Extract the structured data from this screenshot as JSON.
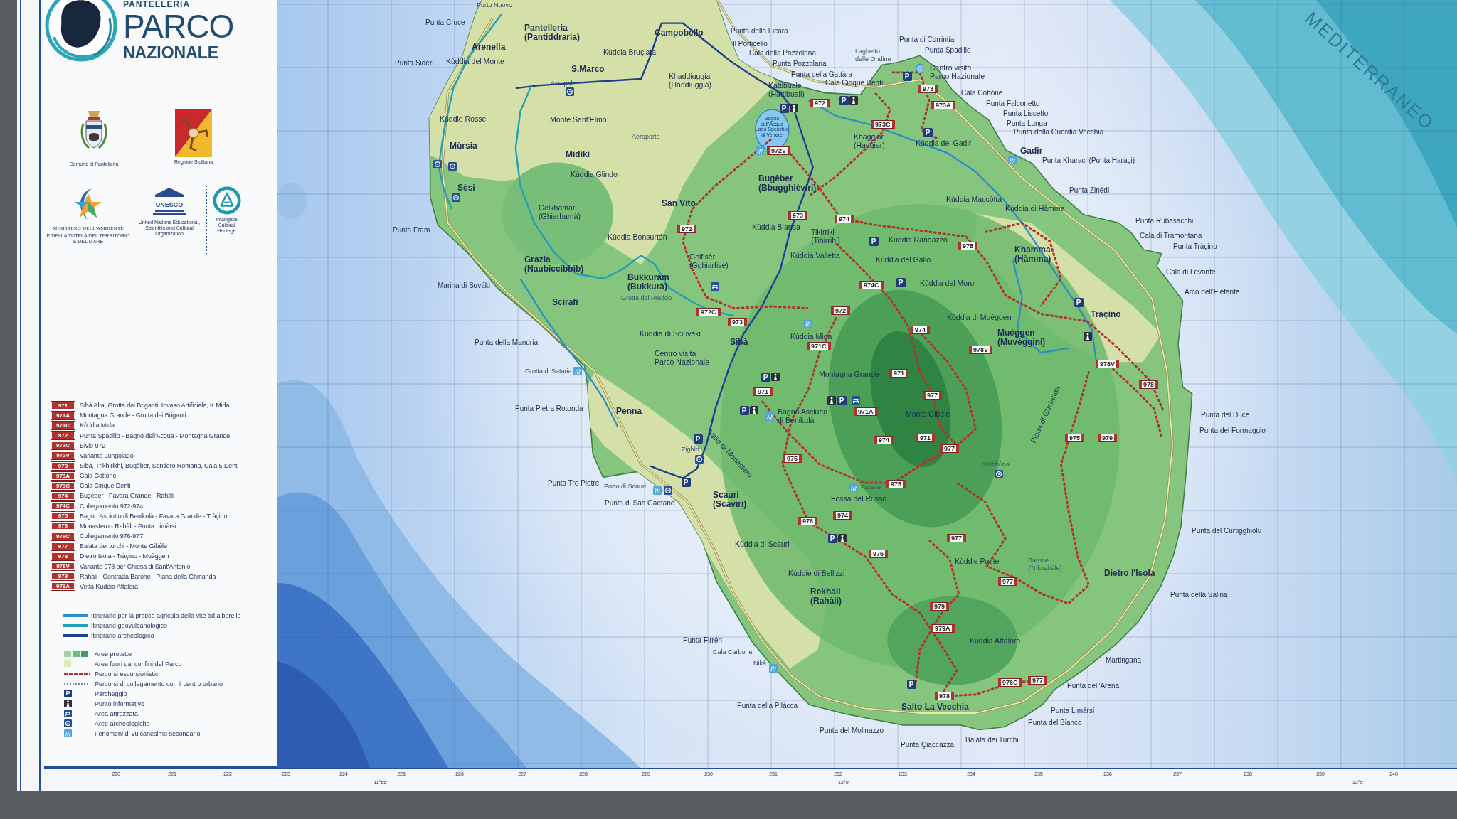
{
  "header": {
    "island_name": "PANTELLERIA",
    "title": "PARCO",
    "subtitle": "NAZIONALE"
  },
  "logos": {
    "comune": "Comune di Pantelleria",
    "regione": "Regione Siciliana",
    "ministero": "MINISTERO DELL'AMBIENTE",
    "ministero_sub": "E DELLA TUTELA DEL TERRITORIO E DEL MARE",
    "unesco_mark": "UNESCO",
    "unesco": "United Nations Educational, Scientific and Cultural Organization",
    "heritage": "Intangible Cultural Heritage"
  },
  "legend": {
    "trails": [
      {
        "code": "971",
        "name": "Sibà Alta, Grotta dei Briganti, Invaso Artificiale, K.Mida"
      },
      {
        "code": "971A",
        "name": "Montagna Grande - Grotta dei Briganti"
      },
      {
        "code": "971C",
        "name": "Kùddia Mida"
      },
      {
        "code": "972",
        "name": "Punta Spadillo - Bagno dell'Acqua - Montagna Grande"
      },
      {
        "code": "972C",
        "name": "Bivio 972"
      },
      {
        "code": "972V",
        "name": "Variante Lungolago"
      },
      {
        "code": "973",
        "name": "Sibà, Trikhirikhi, Bugèber, Sentiero Romano, Cala 5 Denti"
      },
      {
        "code": "973A",
        "name": "Cala Cottòne"
      },
      {
        "code": "973C",
        "name": "Cala Cinque Denti"
      },
      {
        "code": "974",
        "name": "Bugèber - Favara Grande - Rahàli"
      },
      {
        "code": "974C",
        "name": "Collegamento 972-974"
      },
      {
        "code": "975",
        "name": "Bagno Asciutto di Benikulà - Favara Grande - Tràçino"
      },
      {
        "code": "976",
        "name": "Monastero - Rahàli - Punta Limàrsi"
      },
      {
        "code": "976C",
        "name": "Collegamento 976-977"
      },
      {
        "code": "977",
        "name": "Balata dei turchi - Monte Gibèle"
      },
      {
        "code": "978",
        "name": "Dietro Isola - Tràçino - Muèggen"
      },
      {
        "code": "978V",
        "name": "Variante 978 per Chiesa di Sant'Antonio"
      },
      {
        "code": "979",
        "name": "Rahàli - Contrada Barone - Piana della Ghirlanda"
      },
      {
        "code": "979A",
        "name": "Vetta Kùddia Attalòra"
      }
    ],
    "routes": [
      {
        "label": "Itinerario per la pratica agricola della vite ad alberello",
        "color": "#2f8fc4"
      },
      {
        "label": "Itinerario geovulcanologico",
        "color": "#21a0b5"
      },
      {
        "label": "Itinerario archeologico",
        "color": "#213f8f"
      }
    ],
    "symbols": [
      {
        "kind": "protected",
        "label": "Aree protette"
      },
      {
        "kind": "outside",
        "label": "Aree fuori dai confini del Parco"
      },
      {
        "kind": "trail",
        "label": "Percorsi escursionistici"
      },
      {
        "kind": "link",
        "label": "Percorsi di collegamento con il centro urbano"
      },
      {
        "kind": "parking",
        "symbol": "P",
        "label": "Parcheggio"
      },
      {
        "kind": "info",
        "label": "Punto informativo"
      },
      {
        "kind": "picnic",
        "label": "Area attrezzata"
      },
      {
        "kind": "archaeology",
        "label": "Aree archeologiche"
      },
      {
        "kind": "steam",
        "label": "Fenomeni di vulcanesimo secondario"
      }
    ]
  },
  "map": {
    "sea_name": "MEDITERRANEO",
    "coast_labels": [
      {
        "kind": "minor",
        "name": "Porto Nuovo"
      },
      {
        "kind": "point",
        "name": "Punta Croce"
      },
      {
        "kind": "point",
        "name": "Punta della Ficàra"
      },
      {
        "kind": "point",
        "name": "Il Porticello"
      },
      {
        "kind": "point",
        "name": "Punta di Currintia"
      },
      {
        "kind": "point",
        "name": "Cala della Pozzolana"
      },
      {
        "kind": "point",
        "name": "Punta Spadillo"
      },
      {
        "kind": "point",
        "name": "Punta Sidéri"
      },
      {
        "kind": "point",
        "name": "Punta Pozzolana"
      },
      {
        "kind": "point",
        "name": "Punta della Gattàra"
      },
      {
        "kind": "point",
        "name": "Cala Cinque Denti"
      },
      {
        "kind": "point",
        "name": "Cala Cottóne"
      },
      {
        "kind": "point",
        "name": "Punta Falconetto"
      },
      {
        "kind": "point",
        "name": "Punta Liscetto"
      },
      {
        "kind": "point",
        "name": "Punta Lunga"
      },
      {
        "kind": "point",
        "name": "Punta della Guardia Vecchia"
      },
      {
        "kind": "point",
        "name": "Punta Kharaci (Punta Haràçi)"
      },
      {
        "kind": "point",
        "name": "Punta Zinédi"
      },
      {
        "kind": "point",
        "name": "Punta Rubasacchi"
      },
      {
        "kind": "point",
        "name": "Punta Fram"
      },
      {
        "kind": "point",
        "name": "Cala di Tramontana"
      },
      {
        "kind": "point",
        "name": "Punta Tràçino"
      },
      {
        "kind": "point",
        "name": "Cala di Levante"
      },
      {
        "kind": "point",
        "name": "Marina di Suváki"
      },
      {
        "kind": "point",
        "name": "Arco dell'Elefante"
      },
      {
        "kind": "point",
        "name": "Punta della Mandria"
      },
      {
        "kind": "minor",
        "name": "Grotta di Sataria"
      },
      {
        "kind": "point",
        "name": "Punta Pietra Rotonda"
      },
      {
        "kind": "point",
        "name": "Punta del Duce"
      },
      {
        "kind": "point",
        "name": "Punta del Formaggio"
      },
      {
        "kind": "point",
        "name": "Punta Tre Pietre"
      },
      {
        "kind": "minor",
        "name": "Porto di Scauri"
      },
      {
        "kind": "point",
        "name": "Punta di San Gaetano"
      },
      {
        "kind": "point",
        "name": "Punta del Curtigghiólu"
      },
      {
        "kind": "point",
        "name": "Punta della Salina"
      },
      {
        "kind": "point",
        "name": "Punta Firréri"
      },
      {
        "kind": "minor",
        "name": "Cala Carbone"
      },
      {
        "kind": "minor",
        "name": "Nikà"
      },
      {
        "kind": "point",
        "name": "Martingana"
      },
      {
        "kind": "point",
        "name": "Punta dell'Arena"
      },
      {
        "kind": "point",
        "name": "Punta della Pilácca"
      },
      {
        "kind": "point",
        "name": "Punta Limársi"
      },
      {
        "kind": "point",
        "name": "Punta del Bianco"
      },
      {
        "kind": "point",
        "name": "Punta del Molinazzo"
      },
      {
        "kind": "point",
        "name": "Punta Çiaccàzza"
      },
      {
        "kind": "point",
        "name": "Baláta dei Turchi"
      }
    ],
    "place_labels": [
      {
        "kind": "town",
        "lines": [
          "Pantelleria",
          "(Pantiddraria)"
        ]
      },
      {
        "kind": "town",
        "lines": [
          "Campobello"
        ]
      },
      {
        "kind": "town",
        "lines": [
          "Arenella"
        ]
      },
      {
        "kind": "locality",
        "lines": [
          "Kùddia Bruçiata"
        ]
      },
      {
        "kind": "locality",
        "lines": [
          "Kùddia del Monte"
        ]
      },
      {
        "kind": "minor",
        "lines": [
          "Laghetto",
          "delle Ondine"
        ]
      },
      {
        "kind": "town",
        "lines": [
          "S.Marco"
        ]
      },
      {
        "kind": "minor",
        "lines": [
          "Acropoli"
        ]
      },
      {
        "kind": "locality",
        "lines": [
          "Khaddiuggia",
          "(Hàddiuggia)"
        ]
      },
      {
        "kind": "locality",
        "lines": [
          "Centro visita",
          "Parco Nazionale"
        ]
      },
      {
        "kind": "locality",
        "lines": [
          "Kattibuale",
          "(Hattibuali)"
        ]
      },
      {
        "kind": "locality",
        "lines": [
          "Kùddie Rosse"
        ]
      },
      {
        "kind": "locality",
        "lines": [
          "Monte Sant'Elmo"
        ]
      },
      {
        "kind": "minor",
        "lines": [
          "Aeroporto"
        ]
      },
      {
        "kind": "lake",
        "lines": [
          "Bagno",
          "dell'Acqua",
          "Lago Specchio",
          "di Venere"
        ]
      },
      {
        "kind": "town",
        "lines": [
          "Mùrsia"
        ]
      },
      {
        "kind": "locality",
        "lines": [
          "Khaggiar",
          "(Haggiar)"
        ]
      },
      {
        "kind": "locality",
        "lines": [
          "Kùddia del Gadir"
        ]
      },
      {
        "kind": "town",
        "lines": [
          "Midìki"
        ]
      },
      {
        "kind": "town",
        "lines": [
          "Gadir"
        ]
      },
      {
        "kind": "locality",
        "lines": [
          "Kùddia Glindo"
        ]
      },
      {
        "kind": "town",
        "lines": [
          "Sèsi"
        ]
      },
      {
        "kind": "town",
        "lines": [
          "Bugèber",
          "(Bbugghièviri)"
        ]
      },
      {
        "kind": "locality",
        "lines": [
          "Gelkhamar",
          "(Ghiarhamà)"
        ]
      },
      {
        "kind": "town",
        "lines": [
          "San Vito"
        ]
      },
      {
        "kind": "locality",
        "lines": [
          "Kùddia Maccòtta"
        ]
      },
      {
        "kind": "locality",
        "lines": [
          "Kùddia di Hàmma"
        ]
      },
      {
        "kind": "locality",
        "lines": [
          "Kùddia Bianca"
        ]
      },
      {
        "kind": "locality",
        "lines": [
          "Kùddia Bonsurtón"
        ]
      },
      {
        "kind": "locality",
        "lines": [
          "Tikirriki",
          "(Tihirrihi)"
        ]
      },
      {
        "kind": "locality",
        "lines": [
          "Kùddia Randazzo"
        ]
      },
      {
        "kind": "town",
        "lines": [
          "Grazia",
          "(Naubiccibbib)"
        ]
      },
      {
        "kind": "locality",
        "lines": [
          "Gelfisèr",
          "(Gghiarfisè)"
        ]
      },
      {
        "kind": "locality",
        "lines": [
          "Kùddia Valletta"
        ]
      },
      {
        "kind": "locality",
        "lines": [
          "Kùddia del Gallo"
        ]
      },
      {
        "kind": "town",
        "lines": [
          "Khamma",
          "(Hàmma)"
        ]
      },
      {
        "kind": "town",
        "lines": [
          "Bukkuram",
          "(Bukkurà)"
        ]
      },
      {
        "kind": "locality",
        "lines": [
          "Kùddia del Moro"
        ]
      },
      {
        "kind": "town",
        "lines": [
          "Scirafi"
        ]
      },
      {
        "kind": "minor",
        "lines": [
          "Grotta del Preddo"
        ]
      },
      {
        "kind": "locality",
        "lines": [
          "Kùddia di Muéggen"
        ]
      },
      {
        "kind": "town",
        "lines": [
          "Tràçino"
        ]
      },
      {
        "kind": "locality",
        "lines": [
          "Kùddia di Sciuvèki"
        ]
      },
      {
        "kind": "town",
        "lines": [
          "Sibà"
        ]
      },
      {
        "kind": "locality",
        "lines": [
          "Kùddia Mida"
        ]
      },
      {
        "kind": "town",
        "lines": [
          "Muéggen",
          "(Muvèggini)"
        ]
      },
      {
        "kind": "locality",
        "lines": [
          "Centro visita",
          "Parco Nazionale"
        ]
      },
      {
        "kind": "locality",
        "lines": [
          "Montagna Grande"
        ]
      },
      {
        "kind": "town",
        "lines": [
          "Penna"
        ]
      },
      {
        "kind": "locality",
        "lines": [
          "Bagno Asciutto",
          "di Benikulà"
        ]
      },
      {
        "kind": "locality",
        "lines": [
          "Monte Gibéle"
        ]
      },
      {
        "kind": "minor",
        "lines": [
          "Zighìd"
        ]
      },
      {
        "kind": "locality",
        "lines": [
          "Valle di Monastero"
        ]
      },
      {
        "kind": "locality",
        "lines": [
          "Piana di Ghirlanda"
        ]
      },
      {
        "kind": "minor",
        "lines": [
          "Ghibbùna"
        ]
      },
      {
        "kind": "town",
        "lines": [
          "Scauri",
          "(Scàviri)"
        ]
      },
      {
        "kind": "locality",
        "lines": [
          "Fossa del Russo"
        ]
      },
      {
        "kind": "minor",
        "lines": [
          "Favare"
        ]
      },
      {
        "kind": "locality",
        "lines": [
          "Kùddia di Scauri"
        ]
      },
      {
        "kind": "locality",
        "lines": [
          "Kùddie Patite"
        ]
      },
      {
        "kind": "locality",
        "lines": [
          "Kùddie di Bellizzi"
        ]
      },
      {
        "kind": "minor",
        "lines": [
          "Barone",
          "(Triknahàle)"
        ]
      },
      {
        "kind": "town",
        "lines": [
          "Dietro l'Isola"
        ]
      },
      {
        "kind": "town",
        "lines": [
          "Rekhali",
          "(Rahàli)"
        ]
      },
      {
        "kind": "locality",
        "lines": [
          "Kùddia Attalòra"
        ]
      },
      {
        "kind": "town",
        "lines": [
          "Salto La Vecchia"
        ]
      }
    ],
    "trail_numbers": [
      "973",
      "972",
      "973A",
      "973C",
      "972V",
      "973",
      "974",
      "972",
      "978",
      "974C",
      "972C",
      "972",
      "973",
      "974",
      "971C",
      "978V",
      "978V",
      "971",
      "971",
      "978",
      "977",
      "971A",
      "974",
      "971",
      "975",
      "979",
      "977",
      "975",
      "975",
      "976",
      "974",
      "977",
      "976",
      "977",
      "979",
      "979A",
      "976C",
      "977",
      "978"
    ],
    "markers": [
      {
        "kind": "parking",
        "label": "P"
      },
      {
        "kind": "archaeology"
      },
      {
        "kind": "parking",
        "label": "P"
      },
      {
        "kind": "info"
      },
      {
        "kind": "parking",
        "label": "P"
      },
      {
        "kind": "info"
      },
      {
        "kind": "parking",
        "label": "P"
      },
      {
        "kind": "steam"
      },
      {
        "kind": "archaeology"
      },
      {
        "kind": "archaeology"
      },
      {
        "kind": "steam"
      },
      {
        "kind": "archaeology"
      },
      {
        "kind": "parking",
        "label": "P"
      },
      {
        "kind": "picnic"
      },
      {
        "kind": "parking",
        "label": "P"
      },
      {
        "kind": "parking",
        "label": "P"
      },
      {
        "kind": "steam"
      },
      {
        "kind": "info"
      },
      {
        "kind": "steam"
      },
      {
        "kind": "parking",
        "label": "P"
      },
      {
        "kind": "info"
      },
      {
        "kind": "info"
      },
      {
        "kind": "parking",
        "label": "P"
      },
      {
        "kind": "picnic"
      },
      {
        "kind": "parking",
        "label": "P"
      },
      {
        "kind": "info"
      },
      {
        "kind": "steam"
      },
      {
        "kind": "parking",
        "label": "P"
      },
      {
        "kind": "archaeology"
      },
      {
        "kind": "parking",
        "label": "P"
      },
      {
        "kind": "archaeology"
      },
      {
        "kind": "steam"
      },
      {
        "kind": "archaeology"
      },
      {
        "kind": "steam"
      },
      {
        "kind": "parking",
        "label": "P"
      },
      {
        "kind": "info"
      },
      {
        "kind": "steam"
      },
      {
        "kind": "parking",
        "label": "P"
      }
    ]
  },
  "scale": {
    "ticks": [
      "220",
      "221",
      "222",
      "223",
      "224",
      "225",
      "226",
      "227",
      "228",
      "229",
      "230",
      "231",
      "232",
      "233",
      "234",
      "235",
      "236",
      "237",
      "238",
      "239",
      "240"
    ],
    "degrees": [
      "11°55'",
      "12°0'",
      "12°5'"
    ]
  }
}
